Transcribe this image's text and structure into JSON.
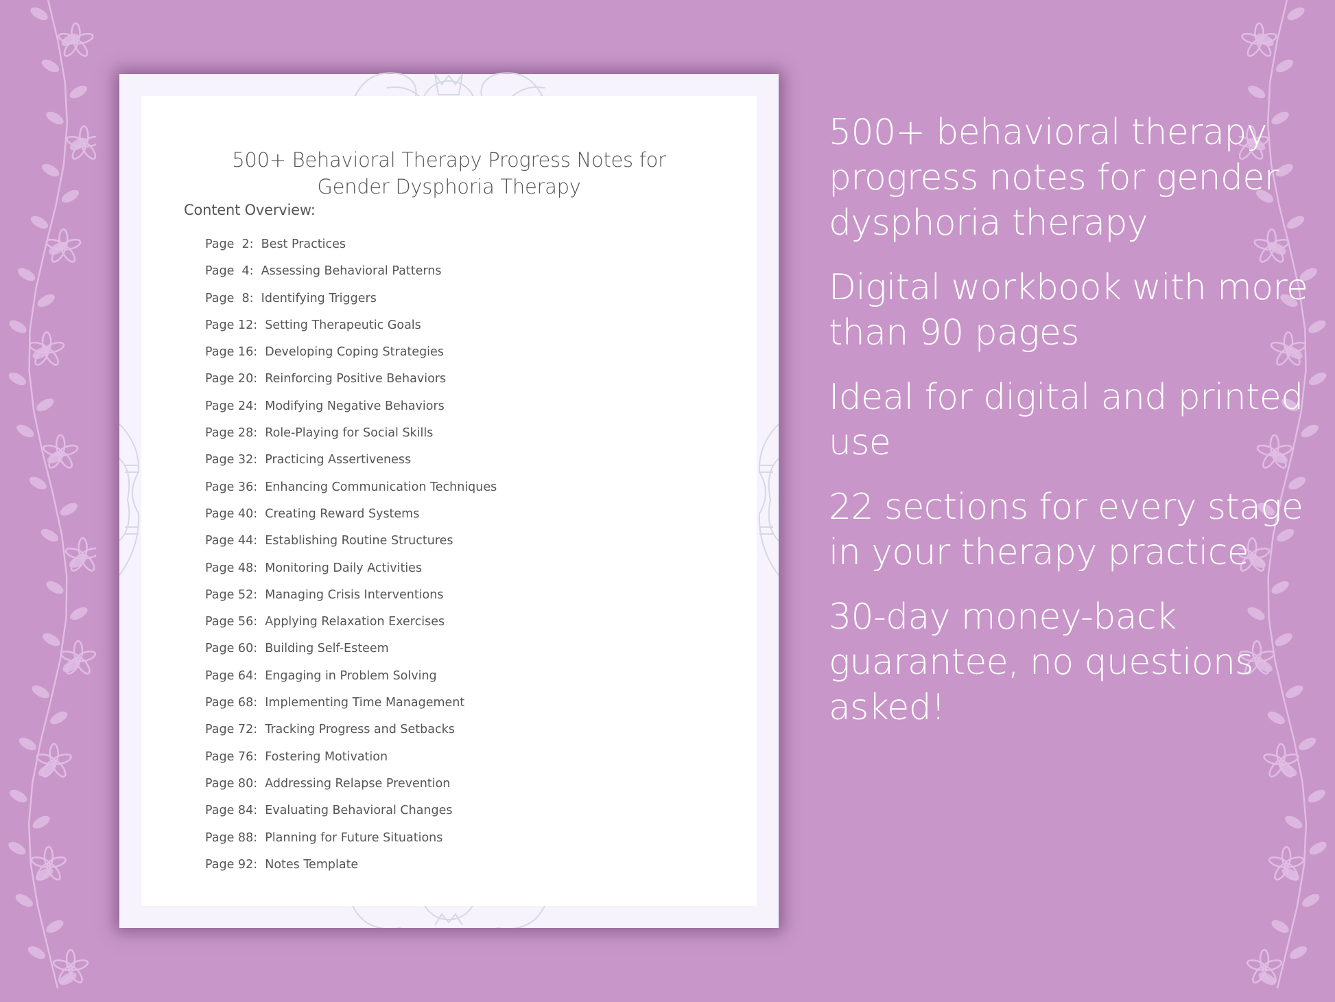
{
  "colors": {
    "background": "#c896c9",
    "vine": "#e0bde3",
    "page_frame": "#f6f3fd",
    "page_inner": "#ffffff",
    "doc_text": "#555555",
    "feature_text": "#ffffff",
    "mandala": "#d5d9e2"
  },
  "document": {
    "title_line1": "500+ Behavioral Therapy Progress Notes for",
    "title_line2": "Gender Dysphoria Therapy",
    "overview_label": "Content Overview:",
    "toc": [
      {
        "page": "Page  2:",
        "title": "Best Practices"
      },
      {
        "page": "Page  4:",
        "title": "Assessing Behavioral Patterns"
      },
      {
        "page": "Page  8:",
        "title": "Identifying Triggers"
      },
      {
        "page": "Page 12:",
        "title": "Setting Therapeutic Goals"
      },
      {
        "page": "Page 16:",
        "title": "Developing Coping Strategies"
      },
      {
        "page": "Page 20:",
        "title": "Reinforcing Positive Behaviors"
      },
      {
        "page": "Page 24:",
        "title": "Modifying Negative Behaviors"
      },
      {
        "page": "Page 28:",
        "title": "Role-Playing for Social Skills"
      },
      {
        "page": "Page 32:",
        "title": "Practicing Assertiveness"
      },
      {
        "page": "Page 36:",
        "title": "Enhancing Communication Techniques"
      },
      {
        "page": "Page 40:",
        "title": "Creating Reward Systems"
      },
      {
        "page": "Page 44:",
        "title": "Establishing Routine Structures"
      },
      {
        "page": "Page 48:",
        "title": "Monitoring Daily Activities"
      },
      {
        "page": "Page 52:",
        "title": "Managing Crisis Interventions"
      },
      {
        "page": "Page 56:",
        "title": "Applying Relaxation Exercises"
      },
      {
        "page": "Page 60:",
        "title": "Building Self-Esteem"
      },
      {
        "page": "Page 64:",
        "title": "Engaging in Problem Solving"
      },
      {
        "page": "Page 68:",
        "title": "Implementing Time Management"
      },
      {
        "page": "Page 72:",
        "title": "Tracking Progress and Setbacks"
      },
      {
        "page": "Page 76:",
        "title": "Fostering Motivation"
      },
      {
        "page": "Page 80:",
        "title": "Addressing Relapse Prevention"
      },
      {
        "page": "Page 84:",
        "title": "Evaluating Behavioral Changes"
      },
      {
        "page": "Page 88:",
        "title": "Planning for Future Situations"
      },
      {
        "page": "Page 92:",
        "title": "Notes Template"
      }
    ]
  },
  "features": [
    "500+ behavioral therapy progress notes for gender dysphoria therapy",
    "Digital workbook with more than 90 pages",
    "Ideal for digital and printed use",
    "22 sections for every stage in your therapy practice",
    "30-day money-back guarantee, no questions asked!"
  ],
  "icons": {
    "left_border": "floral-vine-icon",
    "right_border": "floral-vine-icon",
    "page_decoration": "mandala-icon"
  }
}
